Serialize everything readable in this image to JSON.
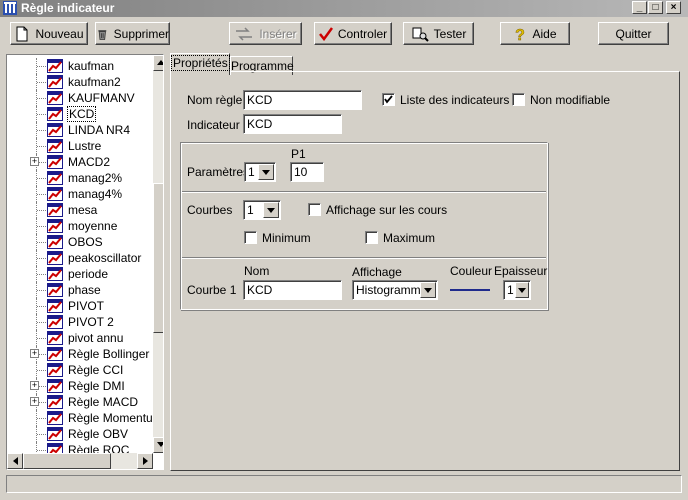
{
  "window": {
    "title": "Règle indicateur"
  },
  "toolbar": {
    "nouveau": "Nouveau",
    "supprimer": "Supprimer",
    "inserer": "Insérer",
    "controler": "Controler",
    "tester": "Tester",
    "aide": "Aide",
    "quitter": "Quitter"
  },
  "tree": {
    "items": [
      {
        "label": "kaufman",
        "expandable": false
      },
      {
        "label": "kaufman2",
        "expandable": false
      },
      {
        "label": "KAUFMANV",
        "expandable": false
      },
      {
        "label": "KCD",
        "expandable": false,
        "selected": true
      },
      {
        "label": "LINDA NR4",
        "expandable": false
      },
      {
        "label": "Lustre",
        "expandable": false
      },
      {
        "label": "MACD2",
        "expandable": true
      },
      {
        "label": "manag2%",
        "expandable": false
      },
      {
        "label": "manag4%",
        "expandable": false
      },
      {
        "label": "mesa",
        "expandable": false
      },
      {
        "label": "moyenne",
        "expandable": false
      },
      {
        "label": "OBOS",
        "expandable": false
      },
      {
        "label": "peakoscillator",
        "expandable": false
      },
      {
        "label": "periode",
        "expandable": false
      },
      {
        "label": "phase",
        "expandable": false
      },
      {
        "label": "PIVOT",
        "expandable": false
      },
      {
        "label": "PIVOT 2",
        "expandable": false
      },
      {
        "label": "pivot annu",
        "expandable": false
      },
      {
        "label": "Règle Bollinger",
        "expandable": true
      },
      {
        "label": "Règle CCI",
        "expandable": false
      },
      {
        "label": "Règle DMI",
        "expandable": true
      },
      {
        "label": "Règle MACD",
        "expandable": true
      },
      {
        "label": "Règle Momentum",
        "expandable": false
      },
      {
        "label": "Règle OBV",
        "expandable": false
      },
      {
        "label": "Règle ROC",
        "expandable": false
      }
    ]
  },
  "tabs": [
    {
      "label": "Propriétés",
      "active": true
    },
    {
      "label": "Programme",
      "active": false
    }
  ],
  "form": {
    "nom_regle_label": "Nom règle",
    "nom_regle_value": "KCD",
    "liste_label": "Liste des indicateurs",
    "liste_checked": true,
    "non_modifiable_label": "Non modifiable",
    "non_modifiable_checked": false,
    "indicateur_label": "Indicateur",
    "indicateur_value": "KCD",
    "p1_label": "P1",
    "parametres_label": "Paramètres",
    "parametres_value": "1",
    "p1_value": "10",
    "courbes_label": "Courbes",
    "courbes_value": "1",
    "affichage_cours_label": "Affichage sur les cours",
    "affichage_cours_checked": false,
    "minimum_label": "Minimum",
    "minimum_checked": false,
    "maximum_label": "Maximum",
    "maximum_checked": false,
    "nom_header": "Nom",
    "affichage_header": "Affichage",
    "couleur_header": "Couleur",
    "epaisseur_header": "Epaisseur",
    "courbe1_label": "Courbe 1",
    "courbe1_nom": "KCD",
    "courbe1_affichage": "Histogramme",
    "courbe1_couleur": "#1f2a8c",
    "courbe1_epaisseur": "1"
  }
}
